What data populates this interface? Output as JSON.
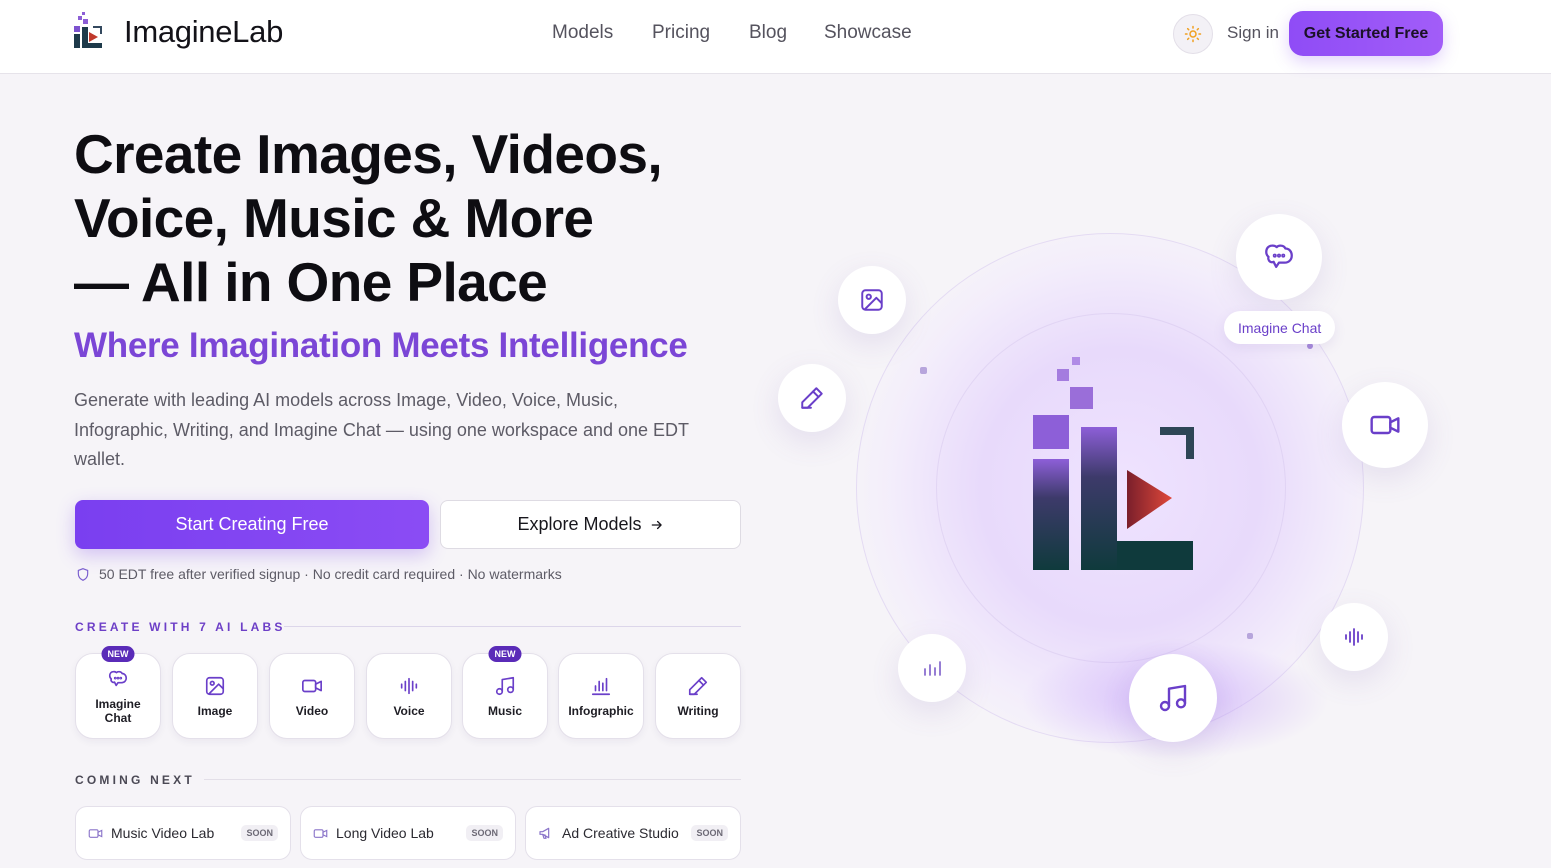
{
  "header": {
    "brand": "ImagineLab",
    "nav": [
      "Models",
      "Pricing",
      "Blog",
      "Showcase"
    ],
    "signin_label": "Sign in",
    "cta_label": "Get Started Free"
  },
  "hero": {
    "headline": [
      "Create Images, Videos,",
      "Voice, Music & More",
      "— All in One Place"
    ],
    "tagline": "Where Imagination Meets Intelligence",
    "description": "Generate with leading AI models across Image, Video, Voice, Music, Infographic, Writing, and Imagine Chat — using one workspace and one EDT wallet.",
    "primary_button": "Start Creating Free",
    "secondary_button": "Explore Models",
    "note": "50 EDT free after verified signup · No credit card required · No watermarks"
  },
  "labs": {
    "heading": "CREATE WITH 7 AI LABS",
    "items": [
      {
        "label": "Imagine Chat",
        "icon": "chat-icon",
        "badge": "NEW"
      },
      {
        "label": "Image",
        "icon": "image-icon",
        "badge": ""
      },
      {
        "label": "Video",
        "icon": "video-icon",
        "badge": ""
      },
      {
        "label": "Voice",
        "icon": "voice-wave-icon",
        "badge": ""
      },
      {
        "label": "Music",
        "icon": "music-note-icon",
        "badge": "NEW"
      },
      {
        "label": "Infographic",
        "icon": "bar-chart-icon",
        "badge": ""
      },
      {
        "label": "Writing",
        "icon": "pen-icon",
        "badge": ""
      }
    ]
  },
  "coming_next": {
    "heading": "COMING NEXT",
    "items": [
      {
        "label": "Music Video Lab",
        "icon": "video-icon",
        "badge": "SOON"
      },
      {
        "label": "Long Video Lab",
        "icon": "video-icon",
        "badge": "SOON"
      },
      {
        "label": "Ad Creative Studio",
        "icon": "megaphone-icon",
        "badge": "SOON"
      }
    ]
  },
  "visual": {
    "chat_pill": "Imagine Chat",
    "orbit_icons": [
      "image-icon",
      "pen-icon",
      "chat-icon",
      "video-icon",
      "bar-chart-icon",
      "music-note-icon",
      "voice-wave-icon"
    ]
  },
  "colors": {
    "accent": "#8b4cf4",
    "accent_text": "#7b46d6",
    "badge": "#5a2bb8",
    "background": "#f6f4f8",
    "logo_dark": "#0f3a3c",
    "logo_red": "#c0392b"
  }
}
